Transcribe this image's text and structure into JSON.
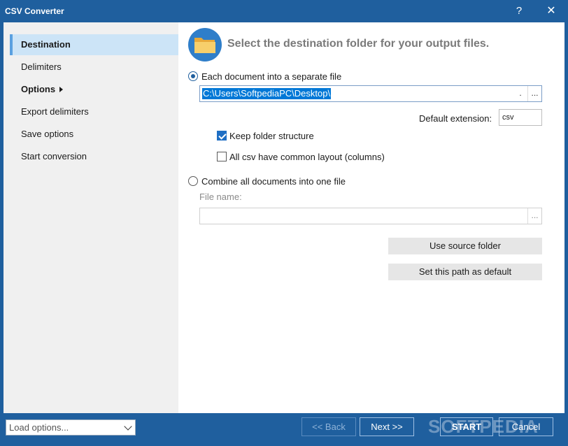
{
  "window": {
    "title": "CSV Converter",
    "help_glyph": "?",
    "close_glyph": "✕"
  },
  "sidebar": {
    "items": [
      {
        "label": "Destination"
      },
      {
        "label": "Delimiters"
      },
      {
        "label": "Options"
      },
      {
        "label": "Export delimiters"
      },
      {
        "label": "Save options"
      },
      {
        "label": "Start conversion"
      }
    ]
  },
  "main": {
    "heading": "Select the destination folder for your output files.",
    "separate_option": "Each document into a separate file",
    "path_value": "C:\\Users\\SoftpediaPC\\Desktop\\",
    "dot_btn": ".",
    "browse_btn": "...",
    "ext_label": "Default extension:",
    "ext_value": "csv",
    "keep_structure": "Keep folder structure",
    "common_layout": "All csv have common layout (columns)",
    "combine_option": "Combine all documents into one file",
    "file_name_label": "File name:",
    "file_browse_btn": "...",
    "use_source_btn": "Use source folder",
    "set_default_btn": "Set this path as default"
  },
  "footer": {
    "load_options": "Load options...",
    "back": "<< Back",
    "next": "Next >>",
    "start": "START",
    "cancel": "Cancel",
    "watermark": "SOFTPEDIA"
  },
  "colors": {
    "accent": "#1f5f9e",
    "selection": "#0078d7",
    "sidebar": "#f0f0f0"
  }
}
